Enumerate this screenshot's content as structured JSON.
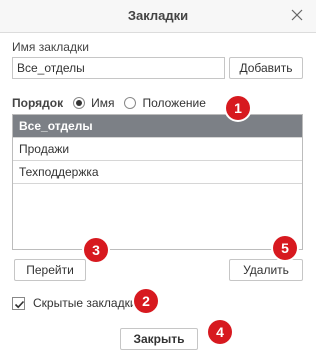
{
  "dialog": {
    "title": "Закладки"
  },
  "form": {
    "name_label": "Имя закладки",
    "name_value": "Все_отделы",
    "add_button": "Добавить",
    "order_label": "Порядок",
    "order_options": [
      {
        "label": "Имя",
        "checked": true
      },
      {
        "label": "Положение",
        "checked": false
      }
    ]
  },
  "list": {
    "items": [
      {
        "label": "Все_отделы",
        "selected": true
      },
      {
        "label": "Продажи",
        "selected": false
      },
      {
        "label": "Техподдержка",
        "selected": false
      }
    ]
  },
  "actions": {
    "go_button": "Перейти",
    "delete_button": "Удалить",
    "hidden_bookmarks_label": "Скрытые закладки",
    "hidden_bookmarks_checked": true,
    "close_button": "Закрыть"
  },
  "annotations": {
    "badge_1": "1",
    "badge_2": "2",
    "badge_3": "3",
    "badge_4": "4",
    "badge_5": "5",
    "badge_color": "#d7191f"
  }
}
